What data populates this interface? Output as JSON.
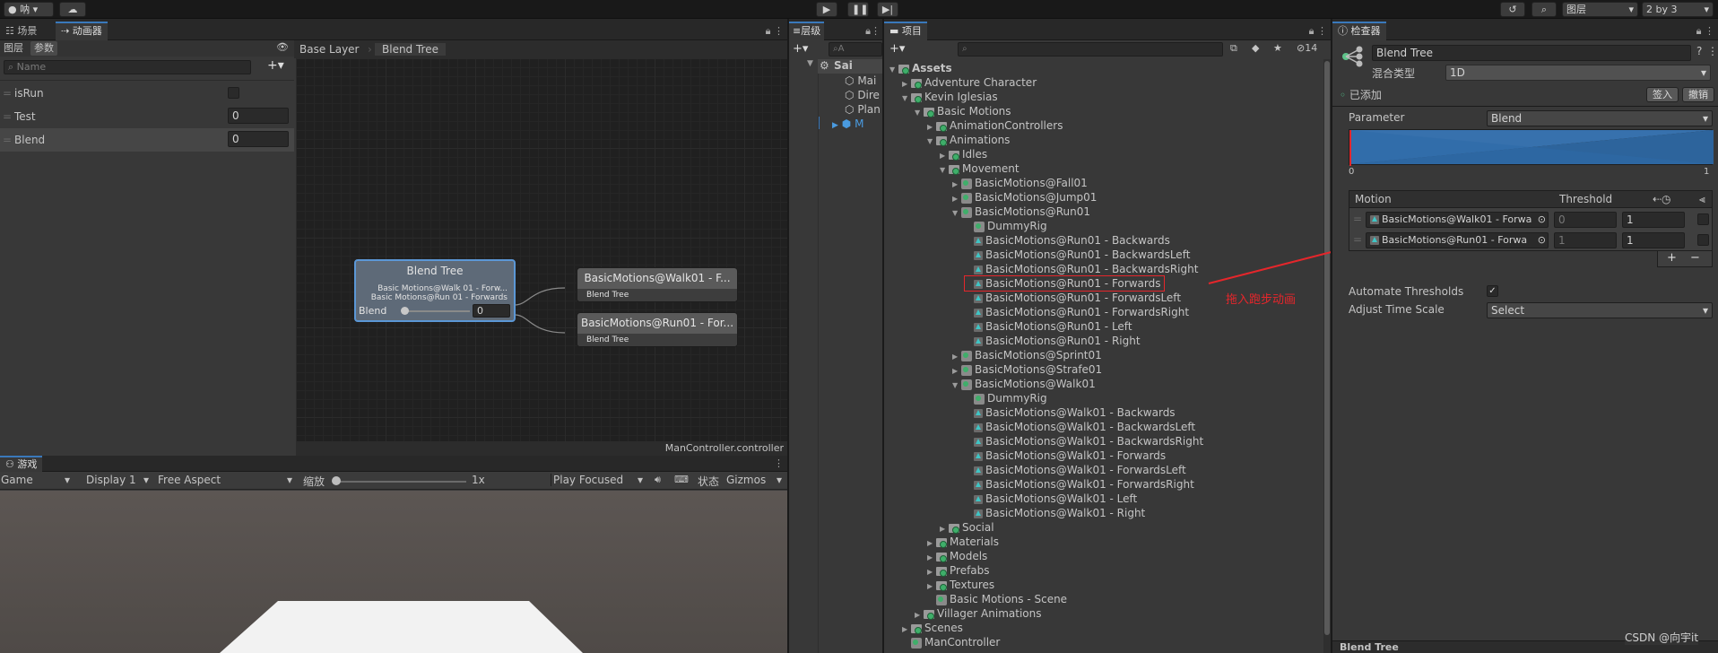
{
  "top": {
    "account_label": "呐",
    "layers_label": "图层",
    "layout_label": "2 by 3"
  },
  "animator": {
    "scene_tab": "场景",
    "animator_tab": "动画器",
    "left_tabs": [
      "图层",
      "参数"
    ],
    "search_placeholder": "Name",
    "params": [
      {
        "name": "isRun",
        "type": "bool",
        "value": ""
      },
      {
        "name": "Test",
        "type": "float",
        "value": "0"
      },
      {
        "name": "Blend",
        "type": "float",
        "value": "0"
      }
    ],
    "breadcrumb": [
      "Base Layer",
      "Blend Tree"
    ],
    "footer": "ManController.controller",
    "blend_node": {
      "title": "Blend Tree",
      "motions": [
        "Basic Motions@Walk 01 - Forw...",
        "Basic Motions@Run 01 - Forwards"
      ],
      "param_label": "Blend",
      "param_value": "0"
    },
    "child_nodes": [
      {
        "title": "BasicMotions@Walk01 - F...",
        "sub": "Blend Tree"
      },
      {
        "title": "BasicMotions@Run01 - For...",
        "sub": "Blend Tree"
      }
    ]
  },
  "game": {
    "tab": "游戏",
    "display_mode": "Game",
    "display": "Display 1",
    "aspect": "Free Aspect",
    "zoom_label": "缩放",
    "zoom_value": "1x",
    "play_mode": "Play Focused",
    "stats": "状态",
    "gizmos": "Gizmos"
  },
  "hierarchy": {
    "tab": "层级",
    "search_placeholder": "A",
    "scene_name": "Sai",
    "items": [
      "Mai",
      "Dire",
      "Plan",
      "M"
    ]
  },
  "project": {
    "tab": "项目",
    "hidden_count": "14",
    "tree": [
      {
        "label": "Assets",
        "depth": 0,
        "arrow": "open",
        "icon": "folder",
        "bold": true
      },
      {
        "label": "Adventure Character",
        "depth": 1,
        "arrow": "closed",
        "icon": "folder"
      },
      {
        "label": "Kevin Iglesias",
        "depth": 1,
        "arrow": "open",
        "icon": "folder"
      },
      {
        "label": "Basic Motions",
        "depth": 2,
        "arrow": "open",
        "icon": "folder"
      },
      {
        "label": "AnimationControllers",
        "depth": 3,
        "arrow": "closed",
        "icon": "folder"
      },
      {
        "label": "Animations",
        "depth": 3,
        "arrow": "open",
        "icon": "folder"
      },
      {
        "label": "Idles",
        "depth": 4,
        "arrow": "closed",
        "icon": "folder"
      },
      {
        "label": "Movement",
        "depth": 4,
        "arrow": "open",
        "icon": "folder"
      },
      {
        "label": "BasicMotions@Fall01",
        "depth": 5,
        "arrow": "closed",
        "icon": "model"
      },
      {
        "label": "BasicMotions@Jump01",
        "depth": 5,
        "arrow": "closed",
        "icon": "model"
      },
      {
        "label": "BasicMotions@Run01",
        "depth": 5,
        "arrow": "open",
        "icon": "model"
      },
      {
        "label": "DummyRig",
        "depth": 6,
        "arrow": "none",
        "icon": "model"
      },
      {
        "label": "BasicMotions@Run01 - Backwards",
        "depth": 6,
        "arrow": "none",
        "icon": "anim"
      },
      {
        "label": "BasicMotions@Run01 - BackwardsLeft",
        "depth": 6,
        "arrow": "none",
        "icon": "anim"
      },
      {
        "label": "BasicMotions@Run01 - BackwardsRight",
        "depth": 6,
        "arrow": "none",
        "icon": "anim"
      },
      {
        "label": "BasicMotions@Run01 - Forwards",
        "depth": 6,
        "arrow": "none",
        "icon": "anim",
        "highlight": true
      },
      {
        "label": "BasicMotions@Run01 - ForwardsLeft",
        "depth": 6,
        "arrow": "none",
        "icon": "anim"
      },
      {
        "label": "BasicMotions@Run01 - ForwardsRight",
        "depth": 6,
        "arrow": "none",
        "icon": "anim"
      },
      {
        "label": "BasicMotions@Run01 - Left",
        "depth": 6,
        "arrow": "none",
        "icon": "anim"
      },
      {
        "label": "BasicMotions@Run01 - Right",
        "depth": 6,
        "arrow": "none",
        "icon": "anim"
      },
      {
        "label": "BasicMotions@Sprint01",
        "depth": 5,
        "arrow": "closed",
        "icon": "model"
      },
      {
        "label": "BasicMotions@Strafe01",
        "depth": 5,
        "arrow": "closed",
        "icon": "model"
      },
      {
        "label": "BasicMotions@Walk01",
        "depth": 5,
        "arrow": "open",
        "icon": "model"
      },
      {
        "label": "DummyRig",
        "depth": 6,
        "arrow": "none",
        "icon": "model"
      },
      {
        "label": "BasicMotions@Walk01 - Backwards",
        "depth": 6,
        "arrow": "none",
        "icon": "anim"
      },
      {
        "label": "BasicMotions@Walk01 - BackwardsLeft",
        "depth": 6,
        "arrow": "none",
        "icon": "anim"
      },
      {
        "label": "BasicMotions@Walk01 - BackwardsRight",
        "depth": 6,
        "arrow": "none",
        "icon": "anim"
      },
      {
        "label": "BasicMotions@Walk01 - Forwards",
        "depth": 6,
        "arrow": "none",
        "icon": "anim"
      },
      {
        "label": "BasicMotions@Walk01 - ForwardsLeft",
        "depth": 6,
        "arrow": "none",
        "icon": "anim"
      },
      {
        "label": "BasicMotions@Walk01 - ForwardsRight",
        "depth": 6,
        "arrow": "none",
        "icon": "anim"
      },
      {
        "label": "BasicMotions@Walk01 - Left",
        "depth": 6,
        "arrow": "none",
        "icon": "anim"
      },
      {
        "label": "BasicMotions@Walk01 - Right",
        "depth": 6,
        "arrow": "none",
        "icon": "anim"
      },
      {
        "label": "Social",
        "depth": 4,
        "arrow": "closed",
        "icon": "folder"
      },
      {
        "label": "Materials",
        "depth": 3,
        "arrow": "closed",
        "icon": "folder"
      },
      {
        "label": "Models",
        "depth": 3,
        "arrow": "closed",
        "icon": "folder"
      },
      {
        "label": "Prefabs",
        "depth": 3,
        "arrow": "closed",
        "icon": "folder"
      },
      {
        "label": "Textures",
        "depth": 3,
        "arrow": "closed",
        "icon": "folder"
      },
      {
        "label": "Basic Motions - Scene",
        "depth": 3,
        "arrow": "none",
        "icon": "scene"
      },
      {
        "label": "Villager Animations",
        "depth": 2,
        "arrow": "closed",
        "icon": "folder"
      },
      {
        "label": "Scenes",
        "depth": 1,
        "arrow": "closed",
        "icon": "folder"
      },
      {
        "label": "ManController",
        "depth": 1,
        "arrow": "none",
        "icon": "controller"
      }
    ]
  },
  "annotation": {
    "text": "拖入跑步动画",
    "color": "#e5262b"
  },
  "inspector": {
    "tab": "检查器",
    "name": "Blend Tree",
    "blend_type_label": "混合类型",
    "blend_type": "1D",
    "added_label": "已添加",
    "sign_in": "签入",
    "undo": "撤销",
    "parameter_label": "Parameter",
    "parameter": "Blend",
    "graph_min": "0",
    "graph_max": "1",
    "col_motion": "Motion",
    "col_threshold": "Threshold",
    "motions": [
      {
        "name": "BasicMotions@Walk01 - Forwa",
        "threshold": "0",
        "speed": "1"
      },
      {
        "name": "BasicMotions@Run01 - Forwa",
        "threshold": "1",
        "speed": "1"
      }
    ],
    "add": "+",
    "remove": "−",
    "automate_label": "Automate Thresholds",
    "automate_checked": "✓",
    "adjust_label": "Adjust Time Scale",
    "adjust_value": "Select",
    "bottom_title": "Blend Tree",
    "watermark": "CSDN @向宇it"
  },
  "colors": {
    "accent": "#3a79bb",
    "annotation": "#e5262b",
    "graph_fill": "#2d6aa8"
  }
}
